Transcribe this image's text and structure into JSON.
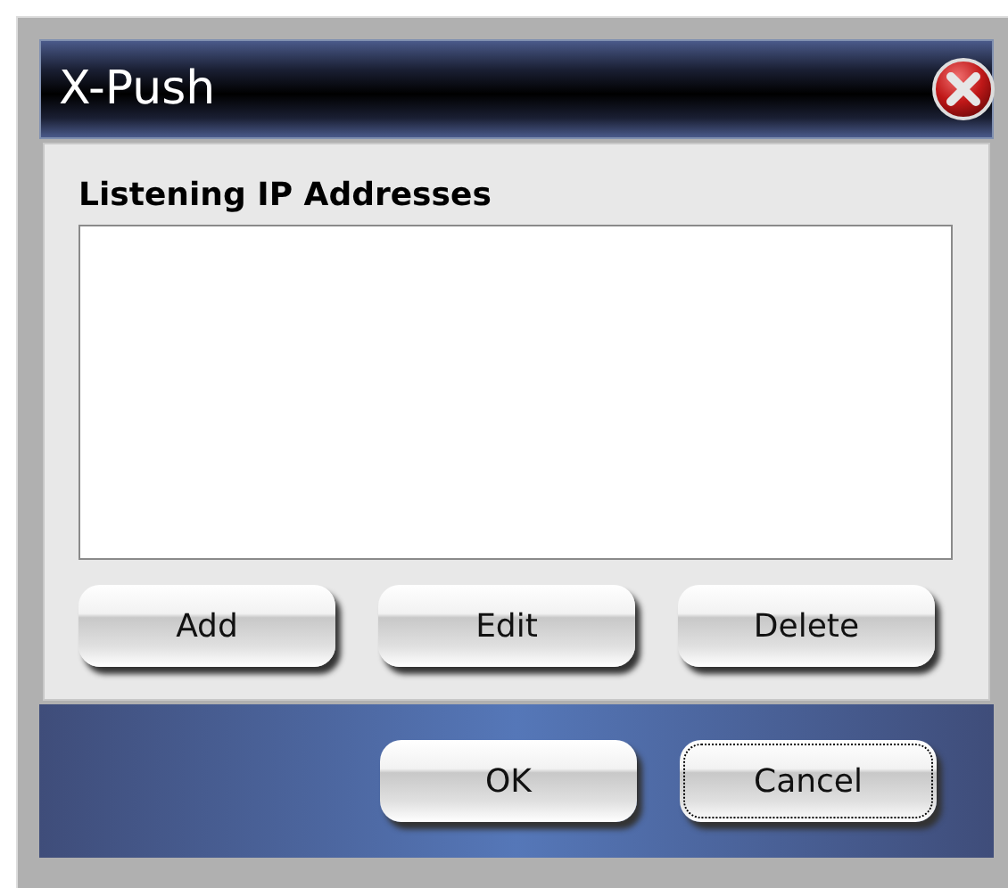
{
  "window": {
    "title": "X-Push"
  },
  "list": {
    "label": "Listening IP Addresses"
  },
  "list_buttons": [
    "Add",
    "Edit",
    "Delete"
  ],
  "footer_buttons": [
    {
      "label": "OK",
      "focused": false
    },
    {
      "label": "Cancel",
      "focused": true
    }
  ]
}
